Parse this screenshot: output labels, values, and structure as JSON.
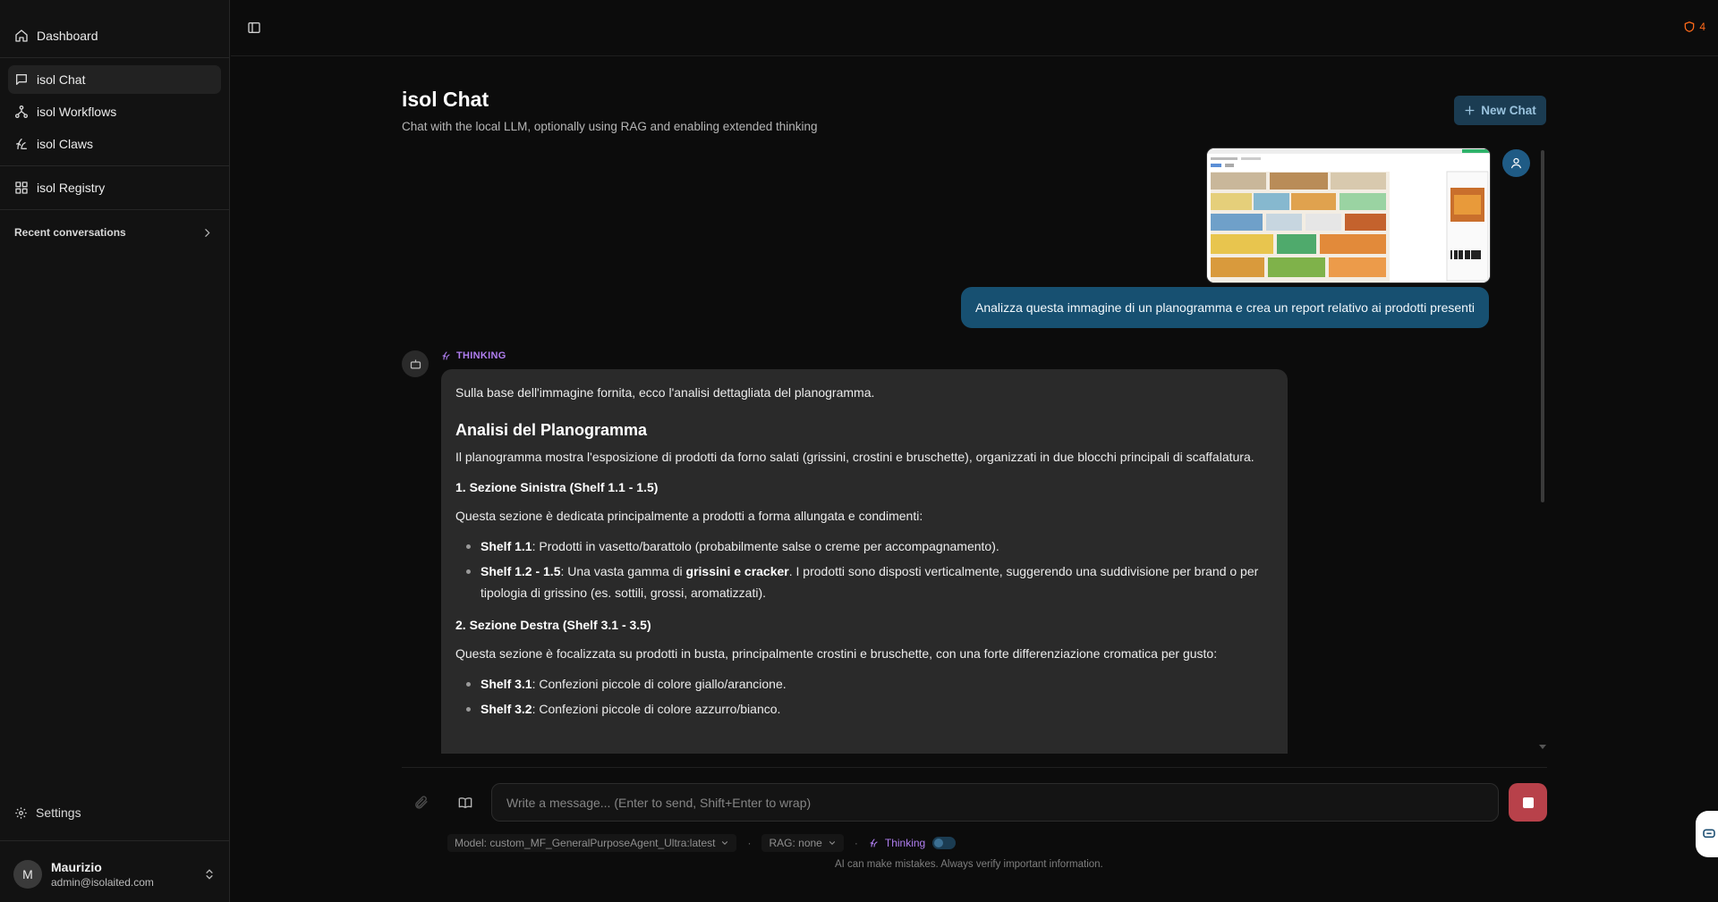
{
  "sidebar": {
    "nav": [
      {
        "label": "Dashboard",
        "icon": "home-icon"
      },
      {
        "label": "isol Chat",
        "icon": "chat-icon",
        "active": true
      },
      {
        "label": "isol Workflows",
        "icon": "workflow-icon"
      },
      {
        "label": "isol Claws",
        "icon": "claws-icon"
      },
      {
        "label": "isol Registry",
        "icon": "grid-icon"
      }
    ],
    "recent_label": "Recent conversations",
    "settings_label": "Settings",
    "user": {
      "initial": "M",
      "name": "Maurizio",
      "email": "admin@isolaited.com"
    }
  },
  "topbar": {
    "alert_count": "4",
    "alert_color": "#ff6a1a"
  },
  "header": {
    "title": "isol Chat",
    "subtitle": "Chat with the local LLM, optionally using RAG and enabling extended thinking",
    "new_chat": "New Chat"
  },
  "messages": {
    "user_text": "Analizza questa immagine di un planogramma e crea un report relativo ai prodotti presenti",
    "thinking_label": "THINKING",
    "bot": {
      "intro": "Sulla base dell'immagine fornita, ecco l'analisi dettagliata del planogramma.",
      "heading": "Analisi del Planogramma",
      "para1": "Il planogramma mostra l'esposizione di prodotti da forno salati (grissini, crostini e bruschette), organizzati in due blocchi principali di scaffalatura.",
      "sec1_title": "1. Sezione Sinistra (Shelf 1.1 - 1.5)",
      "sec1_desc": "Questa sezione è dedicata principalmente a prodotti a forma allungata e condimenti:",
      "sec1_items": [
        {
          "bold": "Shelf 1.1",
          "text": ": Prodotti in vasetto/barattolo (probabilmente salse o creme per accompagnamento)."
        },
        {
          "bold": "Shelf 1.2 - 1.5",
          "pre": ": Una vasta gamma di ",
          "bold2": "grissini e cracker",
          "text": ". I prodotti sono disposti verticalmente, suggerendo una suddivisione per brand o per tipologia di grissino (es. sottili, grossi, aromatizzati)."
        }
      ],
      "sec2_title": "2. Sezione Destra (Shelf 3.1 - 3.5)",
      "sec2_desc": "Questa sezione è focalizzata su prodotti in busta, principalmente crostini e bruschette, con una forte differenziazione cromatica per gusto:",
      "sec2_items": [
        {
          "bold": "Shelf 3.1",
          "text": ": Confezioni piccole di colore giallo/arancione."
        },
        {
          "bold": "Shelf 3.2",
          "text": ": Confezioni piccole di colore azzurro/bianco."
        }
      ]
    }
  },
  "composer": {
    "placeholder": "Write a message... (Enter to send, Shift+Enter to wrap)",
    "model": "Model: custom_MF_GeneralPurposeAgent_Ultra:latest",
    "rag": "RAG: none",
    "thinking": "Thinking",
    "disclaimer": "AI can make mistakes. Always verify important information."
  }
}
